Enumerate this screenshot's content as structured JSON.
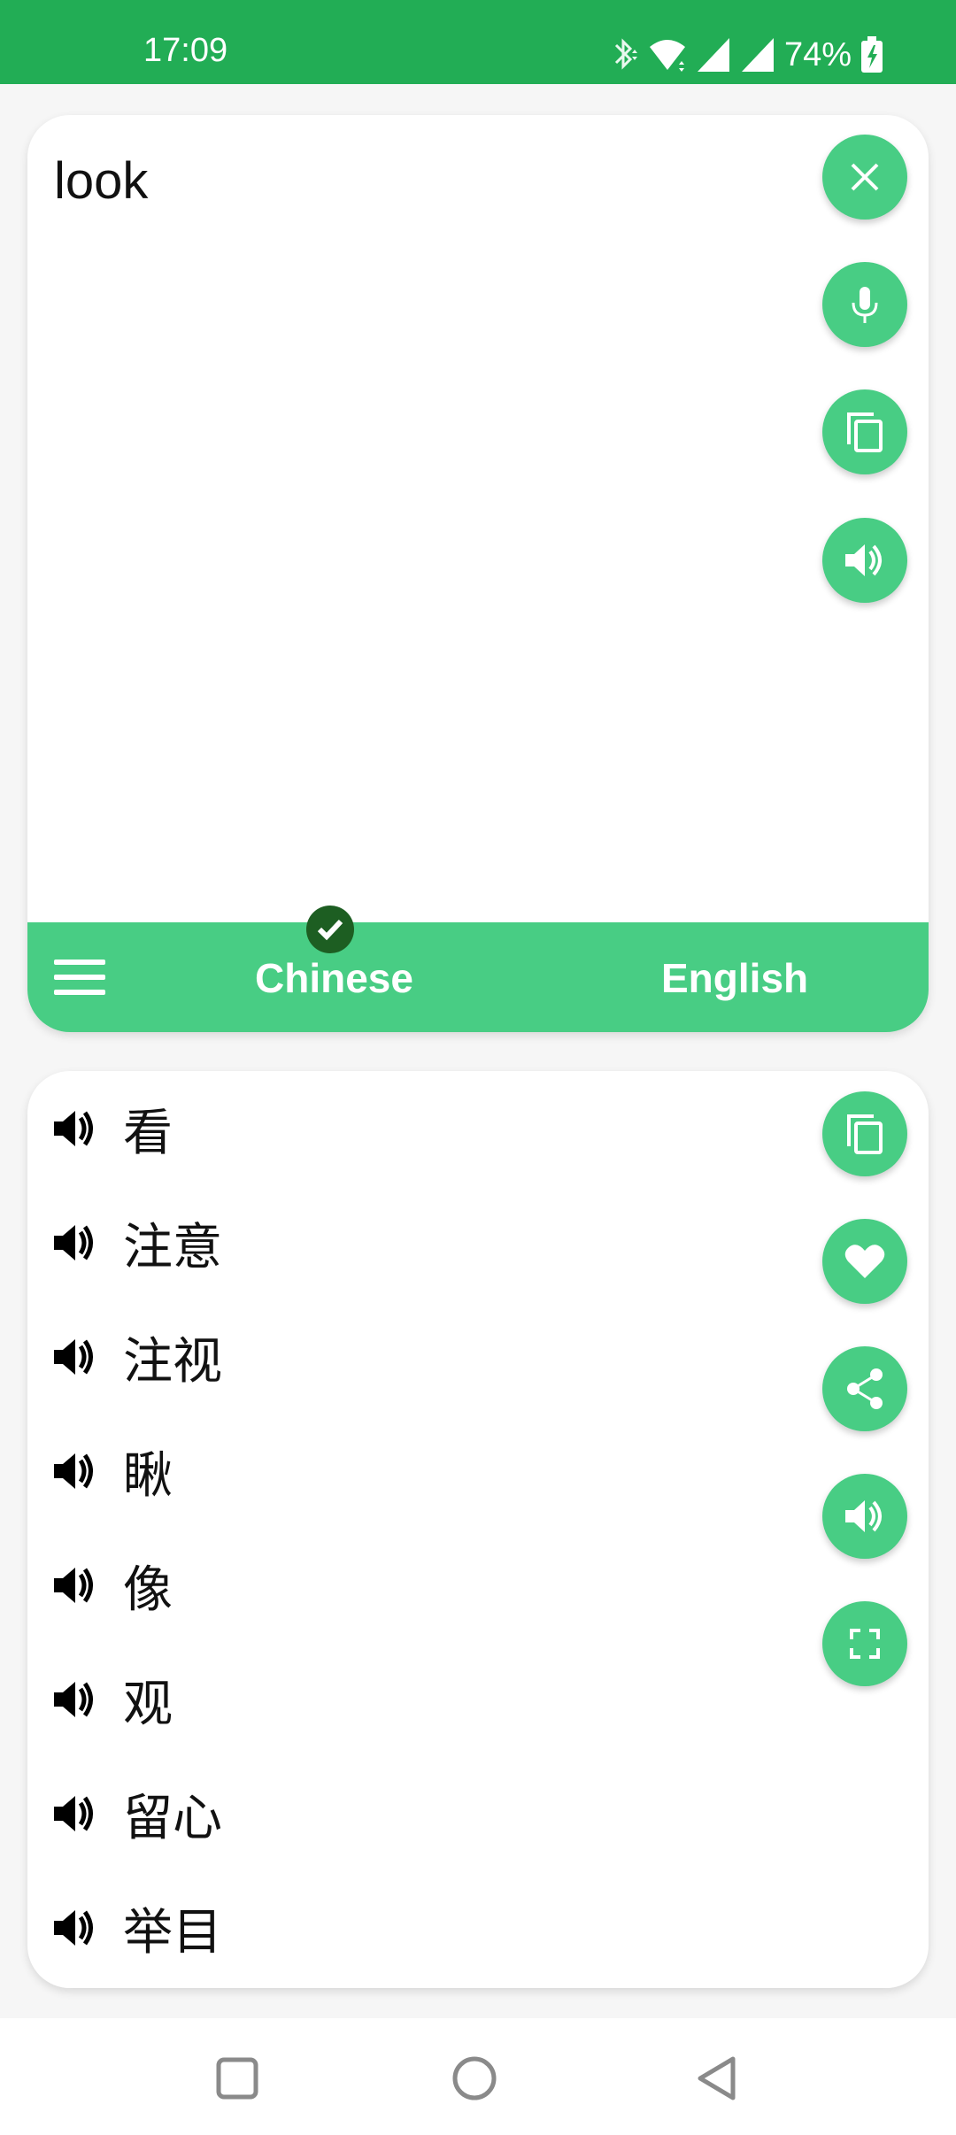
{
  "status_bar": {
    "time": "17:09",
    "battery_percent": "74%",
    "icons": [
      "bluetooth-icon",
      "wifi-icon",
      "signal-icon",
      "signal-icon",
      "battery-charging-icon"
    ]
  },
  "input": {
    "text": "look",
    "actions": [
      {
        "name": "clear-button",
        "icon": "close-icon"
      },
      {
        "name": "voice-input-button",
        "icon": "microphone-icon"
      },
      {
        "name": "copy-input-button",
        "icon": "copy-icon"
      },
      {
        "name": "speak-input-button",
        "icon": "speaker-icon"
      }
    ]
  },
  "language_bar": {
    "source_language": "Chinese",
    "target_language": "English",
    "selected": "Chinese"
  },
  "results": {
    "items": [
      {
        "text": "看"
      },
      {
        "text": "注意"
      },
      {
        "text": "注视"
      },
      {
        "text": "瞅"
      },
      {
        "text": "像"
      },
      {
        "text": "观"
      },
      {
        "text": "留心"
      },
      {
        "text": "举目"
      }
    ],
    "actions": [
      {
        "name": "copy-result-button",
        "icon": "copy-icon"
      },
      {
        "name": "favorite-button",
        "icon": "heart-icon"
      },
      {
        "name": "share-button",
        "icon": "share-icon"
      },
      {
        "name": "speak-result-button",
        "icon": "speaker-icon"
      },
      {
        "name": "fullscreen-button",
        "icon": "fullscreen-icon"
      }
    ]
  },
  "colors": {
    "status_bar": "#22ad55",
    "accent": "#48cd84",
    "check_badge": "#1d5e22",
    "background": "#f6f6f6"
  }
}
